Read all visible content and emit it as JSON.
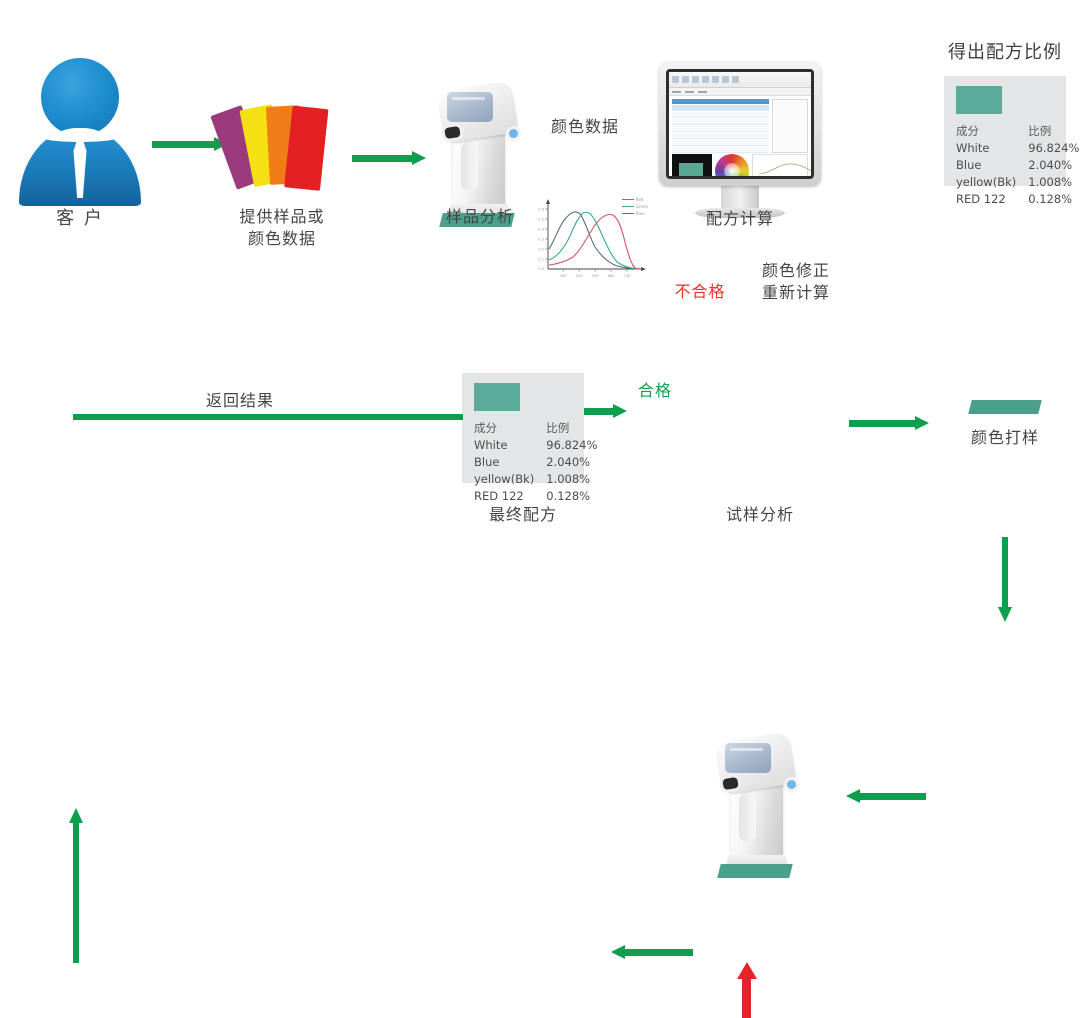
{
  "diagram": {
    "title_right": "得出配方比例",
    "steps": {
      "customer": "客 户",
      "provide_sample": "提供样品或\n颜色数据",
      "sample_analysis": "样品分析",
      "formula_calculation": "配方计算",
      "color_proofing": "颜色打样",
      "trial_analysis": "试样分析",
      "final_formula": "最终配方"
    },
    "arrow_labels": {
      "color_data": "颜色数据",
      "fail": "不合格",
      "correct_recalculate": "颜色修正\n重新计算",
      "pass": "合格",
      "return_result": "返回结果"
    },
    "colors": {
      "arrow_green": "#0f9e4e",
      "arrow_red": "#e2252a",
      "fail_text": "#e8322a",
      "pass_text": "#10a04f",
      "swatch_teal": "#5aab97",
      "panel_bg": "#e3e5e6",
      "person_blue": "#1f8fd0"
    },
    "swatch_fan": [
      {
        "name": "purple-card",
        "color": "#9b3a7d"
      },
      {
        "name": "yellow-card",
        "color": "#f5e013"
      },
      {
        "name": "orange-card",
        "color": "#f07d18"
      },
      {
        "name": "red-card",
        "color": "#e32022"
      }
    ]
  },
  "formula_table": {
    "headers": [
      "成分",
      "比例"
    ],
    "rows": [
      {
        "component": "White",
        "ratio": "96.824%"
      },
      {
        "component": "Blue",
        "ratio": "2.040%"
      },
      {
        "component": "yellow(Bk)",
        "ratio": "1.008%"
      },
      {
        "component": "RED 122",
        "ratio": "0.128%"
      }
    ]
  },
  "chart_data": {
    "type": "line",
    "title": "颜色数据",
    "xlabel": "",
    "ylabel": "",
    "grid": false,
    "legend_position": "top-right",
    "xlim": [
      380,
      780
    ],
    "ylim": [
      0,
      0.7
    ],
    "xticks": [
      "380",
      "450",
      "520",
      "590",
      "660",
      "730"
    ],
    "yticks": [
      "0.0",
      "0.1",
      "0.2",
      "0.3",
      "0.4",
      "0.5",
      "0.6"
    ],
    "x": [
      380,
      420,
      450,
      480,
      500,
      520,
      545,
      570,
      590,
      610,
      630,
      650,
      680,
      700,
      720,
      740,
      760,
      780
    ],
    "series": [
      {
        "name": "Red",
        "color": "#d4536b",
        "values": [
          0.04,
          0.04,
          0.05,
          0.06,
          0.08,
          0.11,
          0.16,
          0.24,
          0.33,
          0.43,
          0.52,
          0.58,
          0.55,
          0.44,
          0.3,
          0.16,
          0.06,
          0.02
        ]
      },
      {
        "name": "Green",
        "color": "#3ba88c",
        "values": [
          0.09,
          0.11,
          0.16,
          0.26,
          0.37,
          0.48,
          0.57,
          0.58,
          0.5,
          0.39,
          0.28,
          0.19,
          0.1,
          0.06,
          0.04,
          0.03,
          0.02,
          0.02
        ]
      },
      {
        "name": "Blue",
        "color": "#5b6b86",
        "values": [
          0.22,
          0.36,
          0.48,
          0.56,
          0.58,
          0.55,
          0.46,
          0.35,
          0.26,
          0.19,
          0.13,
          0.09,
          0.05,
          0.04,
          0.03,
          0.02,
          0.02,
          0.02
        ]
      }
    ]
  }
}
